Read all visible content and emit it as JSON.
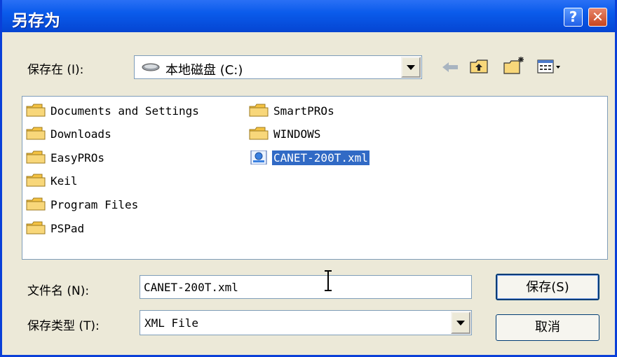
{
  "window": {
    "title": "另存为"
  },
  "title_buttons": {
    "help": "?",
    "close": "✕"
  },
  "save_in": {
    "label": "保存在 (I):",
    "value": "本地磁盘 (C:)",
    "icon": "hard-drive-icon"
  },
  "toolbar": [
    {
      "name": "back-icon"
    },
    {
      "name": "up-folder-icon"
    },
    {
      "name": "new-folder-icon"
    },
    {
      "name": "view-menu-icon"
    }
  ],
  "files": [
    {
      "name": "Documents and Settings",
      "type": "folder"
    },
    {
      "name": "Downloads",
      "type": "folder"
    },
    {
      "name": "EasyPROs",
      "type": "folder"
    },
    {
      "name": "Keil",
      "type": "folder"
    },
    {
      "name": "Program Files",
      "type": "folder"
    },
    {
      "name": "PSPad",
      "type": "folder"
    },
    {
      "name": "SmartPROs",
      "type": "folder"
    },
    {
      "name": "WINDOWS",
      "type": "folder"
    },
    {
      "name": "CANET-200T.xml",
      "type": "xml-file",
      "selected": true
    }
  ],
  "filename": {
    "label": "文件名 (N):",
    "value": "CANET-200T.xml"
  },
  "filetype": {
    "label": "保存类型 (T):",
    "value": "XML File"
  },
  "buttons": {
    "save": "保存(S)",
    "cancel": "取消"
  },
  "colors": {
    "title_bar": "#0A5BEB",
    "dialog_bg": "#ECE9D8",
    "selection": "#316AC5"
  }
}
